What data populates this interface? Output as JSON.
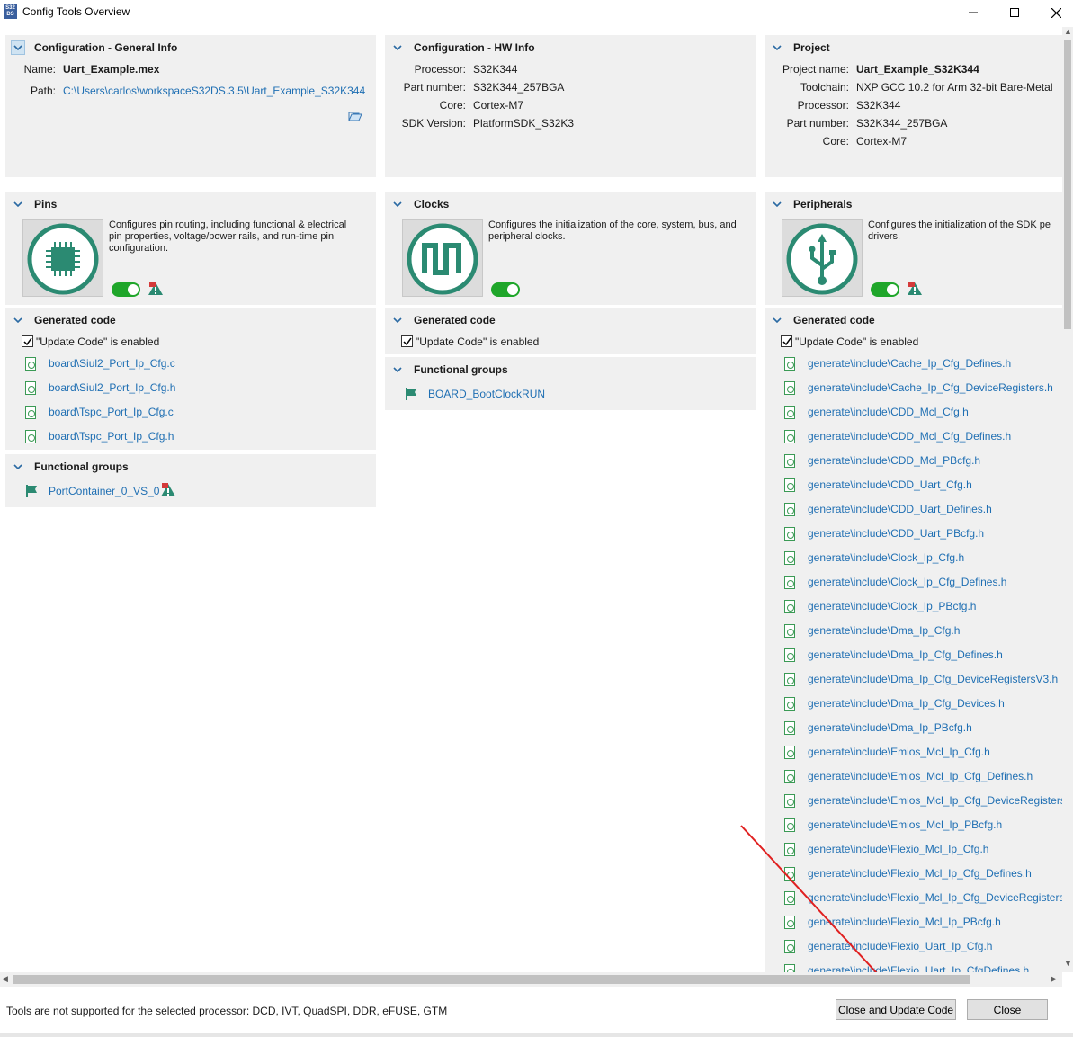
{
  "window": {
    "title": "Config Tools Overview",
    "app_icon_text": "S32 DS"
  },
  "config_general": {
    "heading": "Configuration - General Info",
    "name_label": "Name:",
    "name_value": "Uart_Example.mex",
    "path_label": "Path:",
    "path_value": "C:\\Users\\carlos\\workspaceS32DS.3.5\\Uart_Example_S32K344"
  },
  "config_hw": {
    "heading": "Configuration - HW Info",
    "rows": [
      {
        "label": "Processor:",
        "value": "S32K344"
      },
      {
        "label": "Part number:",
        "value": "S32K344_257BGA"
      },
      {
        "label": "Core:",
        "value": "Cortex-M7"
      },
      {
        "label": "SDK Version:",
        "value": "PlatformSDK_S32K3"
      }
    ]
  },
  "project": {
    "heading": "Project",
    "rows": [
      {
        "label": "Project name:",
        "value": "Uart_Example_S32K344"
      },
      {
        "label": "Toolchain:",
        "value": "NXP GCC 10.2 for Arm 32-bit Bare-Metal"
      },
      {
        "label": "Processor:",
        "value": "S32K344"
      },
      {
        "label": "Part number:",
        "value": "S32K344_257BGA"
      },
      {
        "label": "Core:",
        "value": "Cortex-M7"
      }
    ]
  },
  "pins": {
    "heading": "Pins",
    "description": "Configures pin routing, including functional & electrical pin properties, voltage/power rails, and run-time pin configuration.",
    "generated_heading": "Generated code",
    "update_code_text": "\"Update Code\" is enabled",
    "files": [
      "board\\Siul2_Port_Ip_Cfg.c",
      "board\\Siul2_Port_Ip_Cfg.h",
      "board\\Tspc_Port_Ip_Cfg.c",
      "board\\Tspc_Port_Ip_Cfg.h"
    ],
    "functional_heading": "Functional groups",
    "functional_groups": [
      "PortContainer_0_VS_0"
    ]
  },
  "clocks": {
    "heading": "Clocks",
    "description": "Configures the initialization of the core, system, bus, and peripheral clocks.",
    "generated_heading": "Generated code",
    "update_code_text": "\"Update Code\" is enabled",
    "functional_heading": "Functional groups",
    "functional_groups": [
      "BOARD_BootClockRUN"
    ]
  },
  "peripherals": {
    "heading": "Peripherals",
    "description": "Configures the initialization of the SDK pe drivers.",
    "generated_heading": "Generated code",
    "update_code_text": "\"Update Code\" is enabled",
    "files": [
      "generate\\include\\Cache_Ip_Cfg_Defines.h",
      "generate\\include\\Cache_Ip_Cfg_DeviceRegisters.h",
      "generate\\include\\CDD_Mcl_Cfg.h",
      "generate\\include\\CDD_Mcl_Cfg_Defines.h",
      "generate\\include\\CDD_Mcl_PBcfg.h",
      "generate\\include\\CDD_Uart_Cfg.h",
      "generate\\include\\CDD_Uart_Defines.h",
      "generate\\include\\CDD_Uart_PBcfg.h",
      "generate\\include\\Clock_Ip_Cfg.h",
      "generate\\include\\Clock_Ip_Cfg_Defines.h",
      "generate\\include\\Clock_Ip_PBcfg.h",
      "generate\\include\\Dma_Ip_Cfg.h",
      "generate\\include\\Dma_Ip_Cfg_Defines.h",
      "generate\\include\\Dma_Ip_Cfg_DeviceRegistersV3.h",
      "generate\\include\\Dma_Ip_Cfg_Devices.h",
      "generate\\include\\Dma_Ip_PBcfg.h",
      "generate\\include\\Emios_Mcl_Ip_Cfg.h",
      "generate\\include\\Emios_Mcl_Ip_Cfg_Defines.h",
      "generate\\include\\Emios_Mcl_Ip_Cfg_DeviceRegisters.",
      "generate\\include\\Emios_Mcl_Ip_PBcfg.h",
      "generate\\include\\Flexio_Mcl_Ip_Cfg.h",
      "generate\\include\\Flexio_Mcl_Ip_Cfg_Defines.h",
      "generate\\include\\Flexio_Mcl_Ip_Cfg_DeviceRegisters.",
      "generate\\include\\Flexio_Mcl_Ip_PBcfg.h",
      "generate\\include\\Flexio_Uart_Ip_Cfg.h",
      "generate\\include\\Flexio_Uart_Ip_CfgDefines.h"
    ]
  },
  "status": {
    "message": "Tools are not supported for the selected processor: DCD, IVT, QuadSPI, DDR, eFUSE, GTM",
    "close_update_label": "Close and Update Code",
    "close_label": "Close"
  },
  "colors": {
    "panel_bg": "#f0f0f0",
    "link": "#1f6fb3",
    "accent_green": "#1fa62a",
    "icon_teal": "#2b8a72",
    "annotation_arrow": "#e02020"
  }
}
